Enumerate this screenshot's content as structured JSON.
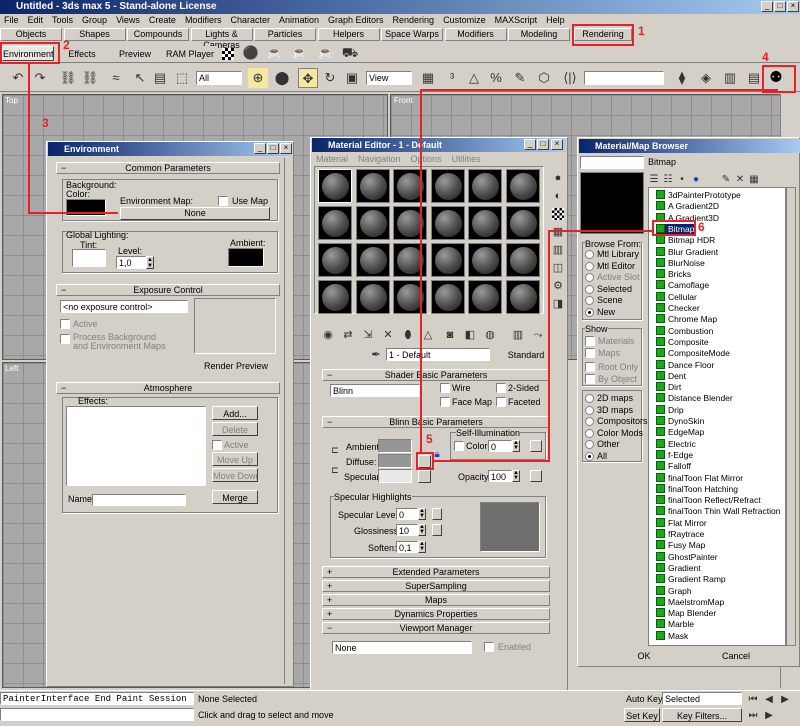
{
  "app": {
    "title": "Untitled - 3ds max 5 - Stand-alone License"
  },
  "menu": [
    "File",
    "Edit",
    "Tools",
    "Group",
    "Views",
    "Create",
    "Modifiers",
    "Character",
    "Animation",
    "Graph Editors",
    "Rendering",
    "Customize",
    "MAXScript",
    "Help"
  ],
  "tabs_row1": [
    "Objects",
    "Shapes",
    "Compounds",
    "Lights & Cameras",
    "Particles",
    "Helpers",
    "Space Warps",
    "Modifiers",
    "Modeling",
    "Rendering"
  ],
  "tabs_row2": [
    "Environments",
    "Effects",
    "Preview",
    "RAM Player"
  ],
  "toolbar": {
    "selection_filter": "All",
    "ref_coord": "View"
  },
  "viewports": {
    "top": "Top",
    "front": "Front",
    "left": "Left"
  },
  "environment": {
    "title": "Environment",
    "common_header": "Common Parameters",
    "background_label": "Background:",
    "color_label": "Color:",
    "env_map_label": "Environment Map:",
    "use_map_label": "Use Map",
    "none_button": "None",
    "global_lighting_label": "Global Lighting:",
    "tint_label": "Tint:",
    "level_label": "Level:",
    "level_value": "1,0",
    "ambient_label": "Ambient:",
    "exposure_header": "Exposure Control",
    "exposure_value": "<no exposure control>",
    "active_label": "Active",
    "process_bg_label1": "Process Background",
    "process_bg_label2": "and Environment Maps",
    "render_preview_button": "Render Preview",
    "atmosphere_header": "Atmosphere",
    "effects_label": "Effects:",
    "add_button": "Add...",
    "delete_button": "Delete",
    "active_chk_label": "Active",
    "move_up_button": "Move Up",
    "move_down_button": "Move Down",
    "name_label": "Name:",
    "merge_button": "Merge"
  },
  "material_editor": {
    "title": "Material Editor - 1 - Default",
    "menu": [
      "Material",
      "Navigation",
      "Options",
      "Utilities"
    ],
    "material_name": "1 - Default",
    "type_button": "Standard",
    "shader_header": "Shader Basic Parameters",
    "shader_value": "Blinn",
    "wire_label": "Wire",
    "two_sided_label": "2-Sided",
    "face_map_label": "Face Map",
    "faceted_label": "Faceted",
    "blinn_header": "Blinn Basic Parameters",
    "self_illum_label": "Self-Illumination",
    "color_label": "Color",
    "color_value": "0",
    "ambient_label": "Ambient:",
    "diffuse_label": "Diffuse:",
    "specular_label": "Specular:",
    "opacity_label": "Opacity:",
    "opacity_value": "100",
    "spec_highlights_label": "Specular Highlights",
    "spec_level_label": "Specular Level:",
    "spec_level_value": "0",
    "glossiness_label": "Glossiness:",
    "glossiness_value": "10",
    "soften_label": "Soften:",
    "soften_value": "0,1",
    "rollouts": [
      "Extended Parameters",
      "SuperSampling",
      "Maps",
      "Dynamics Properties",
      "Viewport Manager"
    ],
    "viewport_value": "None",
    "enabled_label": "Enabled"
  },
  "browser": {
    "title": "Material/Map Browser",
    "selected_name": "Bitmap",
    "browse_from_label": "Browse From:",
    "browse_options": [
      "Mtl Library",
      "Mtl Editor",
      "Active Slot",
      "Selected",
      "Scene",
      "New"
    ],
    "show_label": "Show",
    "show_options": [
      "Materials",
      "Maps",
      "Root Only",
      "By Object"
    ],
    "filter_options": [
      "2D maps",
      "3D maps",
      "Compositors",
      "Color Mods",
      "Other",
      "All"
    ],
    "maps": [
      "3dPainterPrototype",
      "A Gradient2D",
      "A Gradient3D",
      "Bitmap",
      "Bitmap HDR",
      "Blur Gradient",
      "BlurNoise",
      "Bricks",
      "Camoflage",
      "Cellular",
      "Checker",
      "Chrome Map",
      "Combustion",
      "Composite",
      "CompositeMode",
      "Dance Floor",
      "Dent",
      "Dirt",
      "Distance Blender",
      "Drip",
      "DynoSkin",
      "EdgeMap",
      "Electric",
      "f-Edge",
      "Falloff",
      "finalToon Flat Mirror",
      "finalToon Hatching",
      "finalToon Reflect/Refract",
      "finalToon Thin Wall Refraction",
      "Flat Mirror",
      "fRaytrace",
      "Fusy Map",
      "GhostPainter",
      "Gradient",
      "Gradient Ramp",
      "Graph",
      "MaelstromMap",
      "Map Blender",
      "Marble",
      "Mask"
    ],
    "ok_button": "OK",
    "cancel_button": "Cancel"
  },
  "statusbar": {
    "script_text": "PainterInterface End Paint Session",
    "selection": "None Selected",
    "prompt": "Click and drag to select and move",
    "auto_key": "Auto Key",
    "set_key": "Set Key",
    "selected_value": "Selected",
    "key_filters": "Key Filters..."
  },
  "annotations": [
    "1",
    "2",
    "3",
    "4",
    "5",
    "6"
  ],
  "colors": {
    "annotation": "#e8202a",
    "map_icon": "#1aa81a",
    "selection": "#0a246a"
  }
}
